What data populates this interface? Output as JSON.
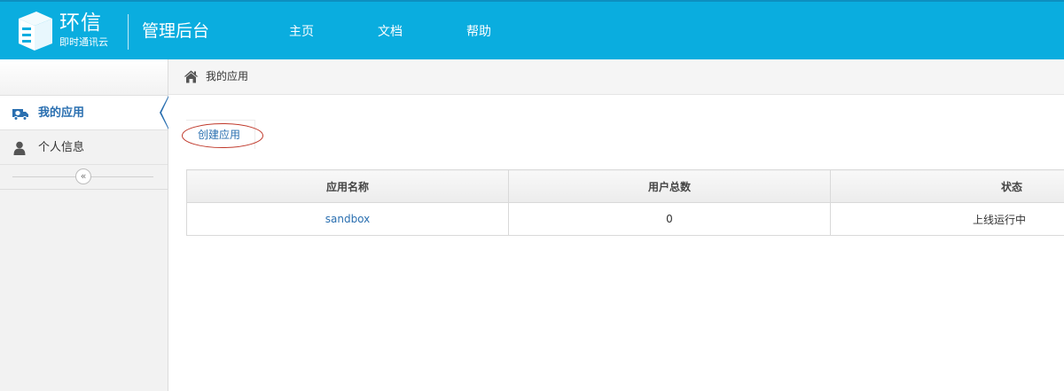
{
  "header": {
    "brand_name": "环信",
    "brand_tagline": "即时通讯云",
    "title": "管理后台",
    "nav": [
      {
        "label": "主页"
      },
      {
        "label": "文档"
      },
      {
        "label": "帮助"
      }
    ],
    "bg_color": "#0aaddf"
  },
  "sidebar": {
    "items": [
      {
        "label": "我的应用",
        "icon": "ambulance-icon",
        "active": true
      },
      {
        "label": "个人信息",
        "icon": "user-icon",
        "active": false
      }
    ],
    "collapse_icon": "double-chevron-left-icon",
    "active_color": "#2a6fb0"
  },
  "breadcrumb": {
    "icon": "home-icon",
    "text": "我的应用"
  },
  "main": {
    "create_button_label": "创建应用",
    "table": {
      "columns": [
        "应用名称",
        "用户总数",
        "状态"
      ],
      "rows": [
        {
          "name": "sandbox",
          "users": "0",
          "status": "上线运行中"
        }
      ]
    }
  }
}
